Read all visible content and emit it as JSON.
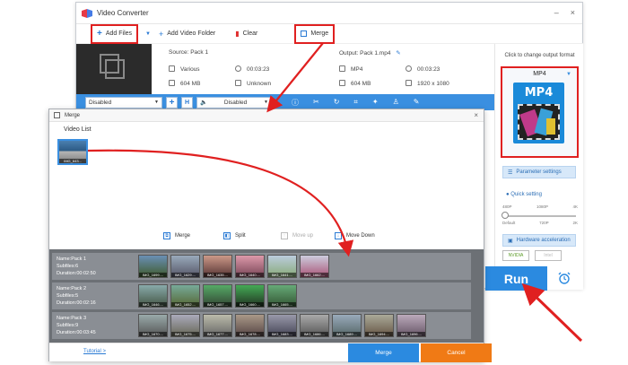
{
  "app": {
    "title": "Video Converter",
    "window_controls": [
      "–",
      "×"
    ]
  },
  "toolbar": {
    "add_files": "Add Files",
    "add_video_folder": "Add Video Folder",
    "clear": "Clear",
    "merge": "Merge"
  },
  "file": {
    "source": "Source: Pack 1",
    "output": "Output: Pack 1.mp4",
    "src_format": "Various",
    "src_duration": "00:03:23",
    "src_size": "604 MB",
    "src_resolution": "Unknown",
    "out_format": "MP4",
    "out_duration": "00:03:23",
    "out_size": "604 MB",
    "out_resolution": "1920 x 1080"
  },
  "edit_bar": {
    "subtitle_select": "Disabled",
    "audio_select": "Disabled",
    "h_button": "H"
  },
  "right_panel": {
    "click_label": "Click to change output format",
    "format": "MP4",
    "icon_text": "MP4",
    "param_settings": "Parameter settings",
    "quick_setting": "Quick setting",
    "top_labels": [
      "480P",
      "1080P",
      "4K"
    ],
    "bottom_labels": [
      "Default",
      "720P",
      "2K"
    ],
    "hw_accel": "Hardware acceleration",
    "chip_nvidia": "NVIDIA",
    "chip_intel": "Intel"
  },
  "run": {
    "label": "Run"
  },
  "merge_dialog": {
    "title": "Merge",
    "video_list_label": "Video List",
    "video_thumb_label": "IMG_643...",
    "actions": {
      "merge": "Merge",
      "split": "Split",
      "move_up": "Move up",
      "move_down": "Move Down"
    },
    "packs": [
      {
        "name": "Name:Pack 1",
        "subfiles": "Subfiles:6",
        "duration": "Duration:00:02:50",
        "thumbs": [
          "IMG_1699....",
          "IMG_1629....",
          "IMG_1635....",
          "IMG_1640....",
          "IMG_1641....",
          "IMG_1662...."
        ]
      },
      {
        "name": "Name:Pack 2",
        "subfiles": "Subfiles:5",
        "duration": "Duration:00:02:16",
        "thumbs": [
          "IMG_1646....",
          "IMG_1652....",
          "IMG_1657....",
          "IMG_1660....",
          "IMG_1665...."
        ]
      },
      {
        "name": "Name:Pack 3",
        "subfiles": "Subfiles:9",
        "duration": "Duration:00:03:45",
        "thumbs": [
          "IMG_1670....",
          "IMG_1675....",
          "IMG_1677....",
          "IMG_1678....",
          "IMG_1683....",
          "IMG_1686....",
          "IMG_1689....",
          "IMG_1694....",
          "IMG_1696...."
        ]
      }
    ],
    "tutorial": "Tutorial >",
    "merge_button": "Merge",
    "cancel_button": "Cancel"
  },
  "colors": {
    "accent": "#2b8ae0",
    "highlight": "#e02020",
    "cancel": "#f07a15"
  }
}
